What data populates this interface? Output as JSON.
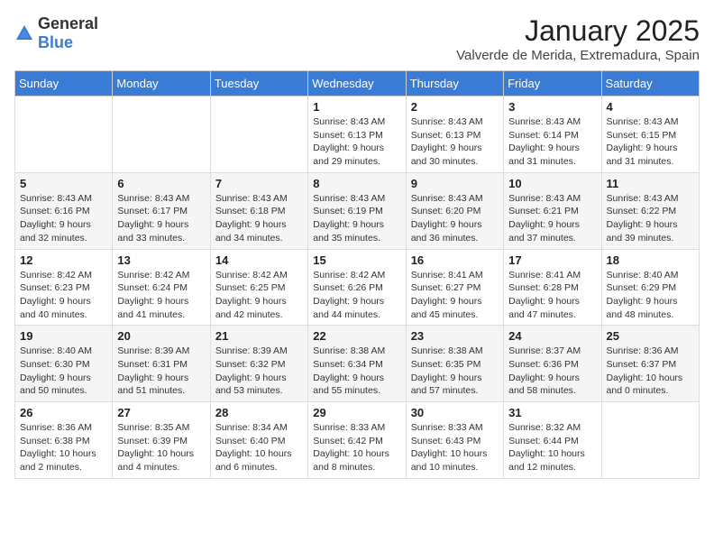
{
  "logo": {
    "general": "General",
    "blue": "Blue"
  },
  "title": "January 2025",
  "location": "Valverde de Merida, Extremadura, Spain",
  "weekdays": [
    "Sunday",
    "Monday",
    "Tuesday",
    "Wednesday",
    "Thursday",
    "Friday",
    "Saturday"
  ],
  "weeks": [
    [
      {
        "day": "",
        "detail": ""
      },
      {
        "day": "",
        "detail": ""
      },
      {
        "day": "",
        "detail": ""
      },
      {
        "day": "1",
        "detail": "Sunrise: 8:43 AM\nSunset: 6:13 PM\nDaylight: 9 hours and 29 minutes."
      },
      {
        "day": "2",
        "detail": "Sunrise: 8:43 AM\nSunset: 6:13 PM\nDaylight: 9 hours and 30 minutes."
      },
      {
        "day": "3",
        "detail": "Sunrise: 8:43 AM\nSunset: 6:14 PM\nDaylight: 9 hours and 31 minutes."
      },
      {
        "day": "4",
        "detail": "Sunrise: 8:43 AM\nSunset: 6:15 PM\nDaylight: 9 hours and 31 minutes."
      }
    ],
    [
      {
        "day": "5",
        "detail": "Sunrise: 8:43 AM\nSunset: 6:16 PM\nDaylight: 9 hours and 32 minutes."
      },
      {
        "day": "6",
        "detail": "Sunrise: 8:43 AM\nSunset: 6:17 PM\nDaylight: 9 hours and 33 minutes."
      },
      {
        "day": "7",
        "detail": "Sunrise: 8:43 AM\nSunset: 6:18 PM\nDaylight: 9 hours and 34 minutes."
      },
      {
        "day": "8",
        "detail": "Sunrise: 8:43 AM\nSunset: 6:19 PM\nDaylight: 9 hours and 35 minutes."
      },
      {
        "day": "9",
        "detail": "Sunrise: 8:43 AM\nSunset: 6:20 PM\nDaylight: 9 hours and 36 minutes."
      },
      {
        "day": "10",
        "detail": "Sunrise: 8:43 AM\nSunset: 6:21 PM\nDaylight: 9 hours and 37 minutes."
      },
      {
        "day": "11",
        "detail": "Sunrise: 8:43 AM\nSunset: 6:22 PM\nDaylight: 9 hours and 39 minutes."
      }
    ],
    [
      {
        "day": "12",
        "detail": "Sunrise: 8:42 AM\nSunset: 6:23 PM\nDaylight: 9 hours and 40 minutes."
      },
      {
        "day": "13",
        "detail": "Sunrise: 8:42 AM\nSunset: 6:24 PM\nDaylight: 9 hours and 41 minutes."
      },
      {
        "day": "14",
        "detail": "Sunrise: 8:42 AM\nSunset: 6:25 PM\nDaylight: 9 hours and 42 minutes."
      },
      {
        "day": "15",
        "detail": "Sunrise: 8:42 AM\nSunset: 6:26 PM\nDaylight: 9 hours and 44 minutes."
      },
      {
        "day": "16",
        "detail": "Sunrise: 8:41 AM\nSunset: 6:27 PM\nDaylight: 9 hours and 45 minutes."
      },
      {
        "day": "17",
        "detail": "Sunrise: 8:41 AM\nSunset: 6:28 PM\nDaylight: 9 hours and 47 minutes."
      },
      {
        "day": "18",
        "detail": "Sunrise: 8:40 AM\nSunset: 6:29 PM\nDaylight: 9 hours and 48 minutes."
      }
    ],
    [
      {
        "day": "19",
        "detail": "Sunrise: 8:40 AM\nSunset: 6:30 PM\nDaylight: 9 hours and 50 minutes."
      },
      {
        "day": "20",
        "detail": "Sunrise: 8:39 AM\nSunset: 6:31 PM\nDaylight: 9 hours and 51 minutes."
      },
      {
        "day": "21",
        "detail": "Sunrise: 8:39 AM\nSunset: 6:32 PM\nDaylight: 9 hours and 53 minutes."
      },
      {
        "day": "22",
        "detail": "Sunrise: 8:38 AM\nSunset: 6:34 PM\nDaylight: 9 hours and 55 minutes."
      },
      {
        "day": "23",
        "detail": "Sunrise: 8:38 AM\nSunset: 6:35 PM\nDaylight: 9 hours and 57 minutes."
      },
      {
        "day": "24",
        "detail": "Sunrise: 8:37 AM\nSunset: 6:36 PM\nDaylight: 9 hours and 58 minutes."
      },
      {
        "day": "25",
        "detail": "Sunrise: 8:36 AM\nSunset: 6:37 PM\nDaylight: 10 hours and 0 minutes."
      }
    ],
    [
      {
        "day": "26",
        "detail": "Sunrise: 8:36 AM\nSunset: 6:38 PM\nDaylight: 10 hours and 2 minutes."
      },
      {
        "day": "27",
        "detail": "Sunrise: 8:35 AM\nSunset: 6:39 PM\nDaylight: 10 hours and 4 minutes."
      },
      {
        "day": "28",
        "detail": "Sunrise: 8:34 AM\nSunset: 6:40 PM\nDaylight: 10 hours and 6 minutes."
      },
      {
        "day": "29",
        "detail": "Sunrise: 8:33 AM\nSunset: 6:42 PM\nDaylight: 10 hours and 8 minutes."
      },
      {
        "day": "30",
        "detail": "Sunrise: 8:33 AM\nSunset: 6:43 PM\nDaylight: 10 hours and 10 minutes."
      },
      {
        "day": "31",
        "detail": "Sunrise: 8:32 AM\nSunset: 6:44 PM\nDaylight: 10 hours and 12 minutes."
      },
      {
        "day": "",
        "detail": ""
      }
    ]
  ]
}
